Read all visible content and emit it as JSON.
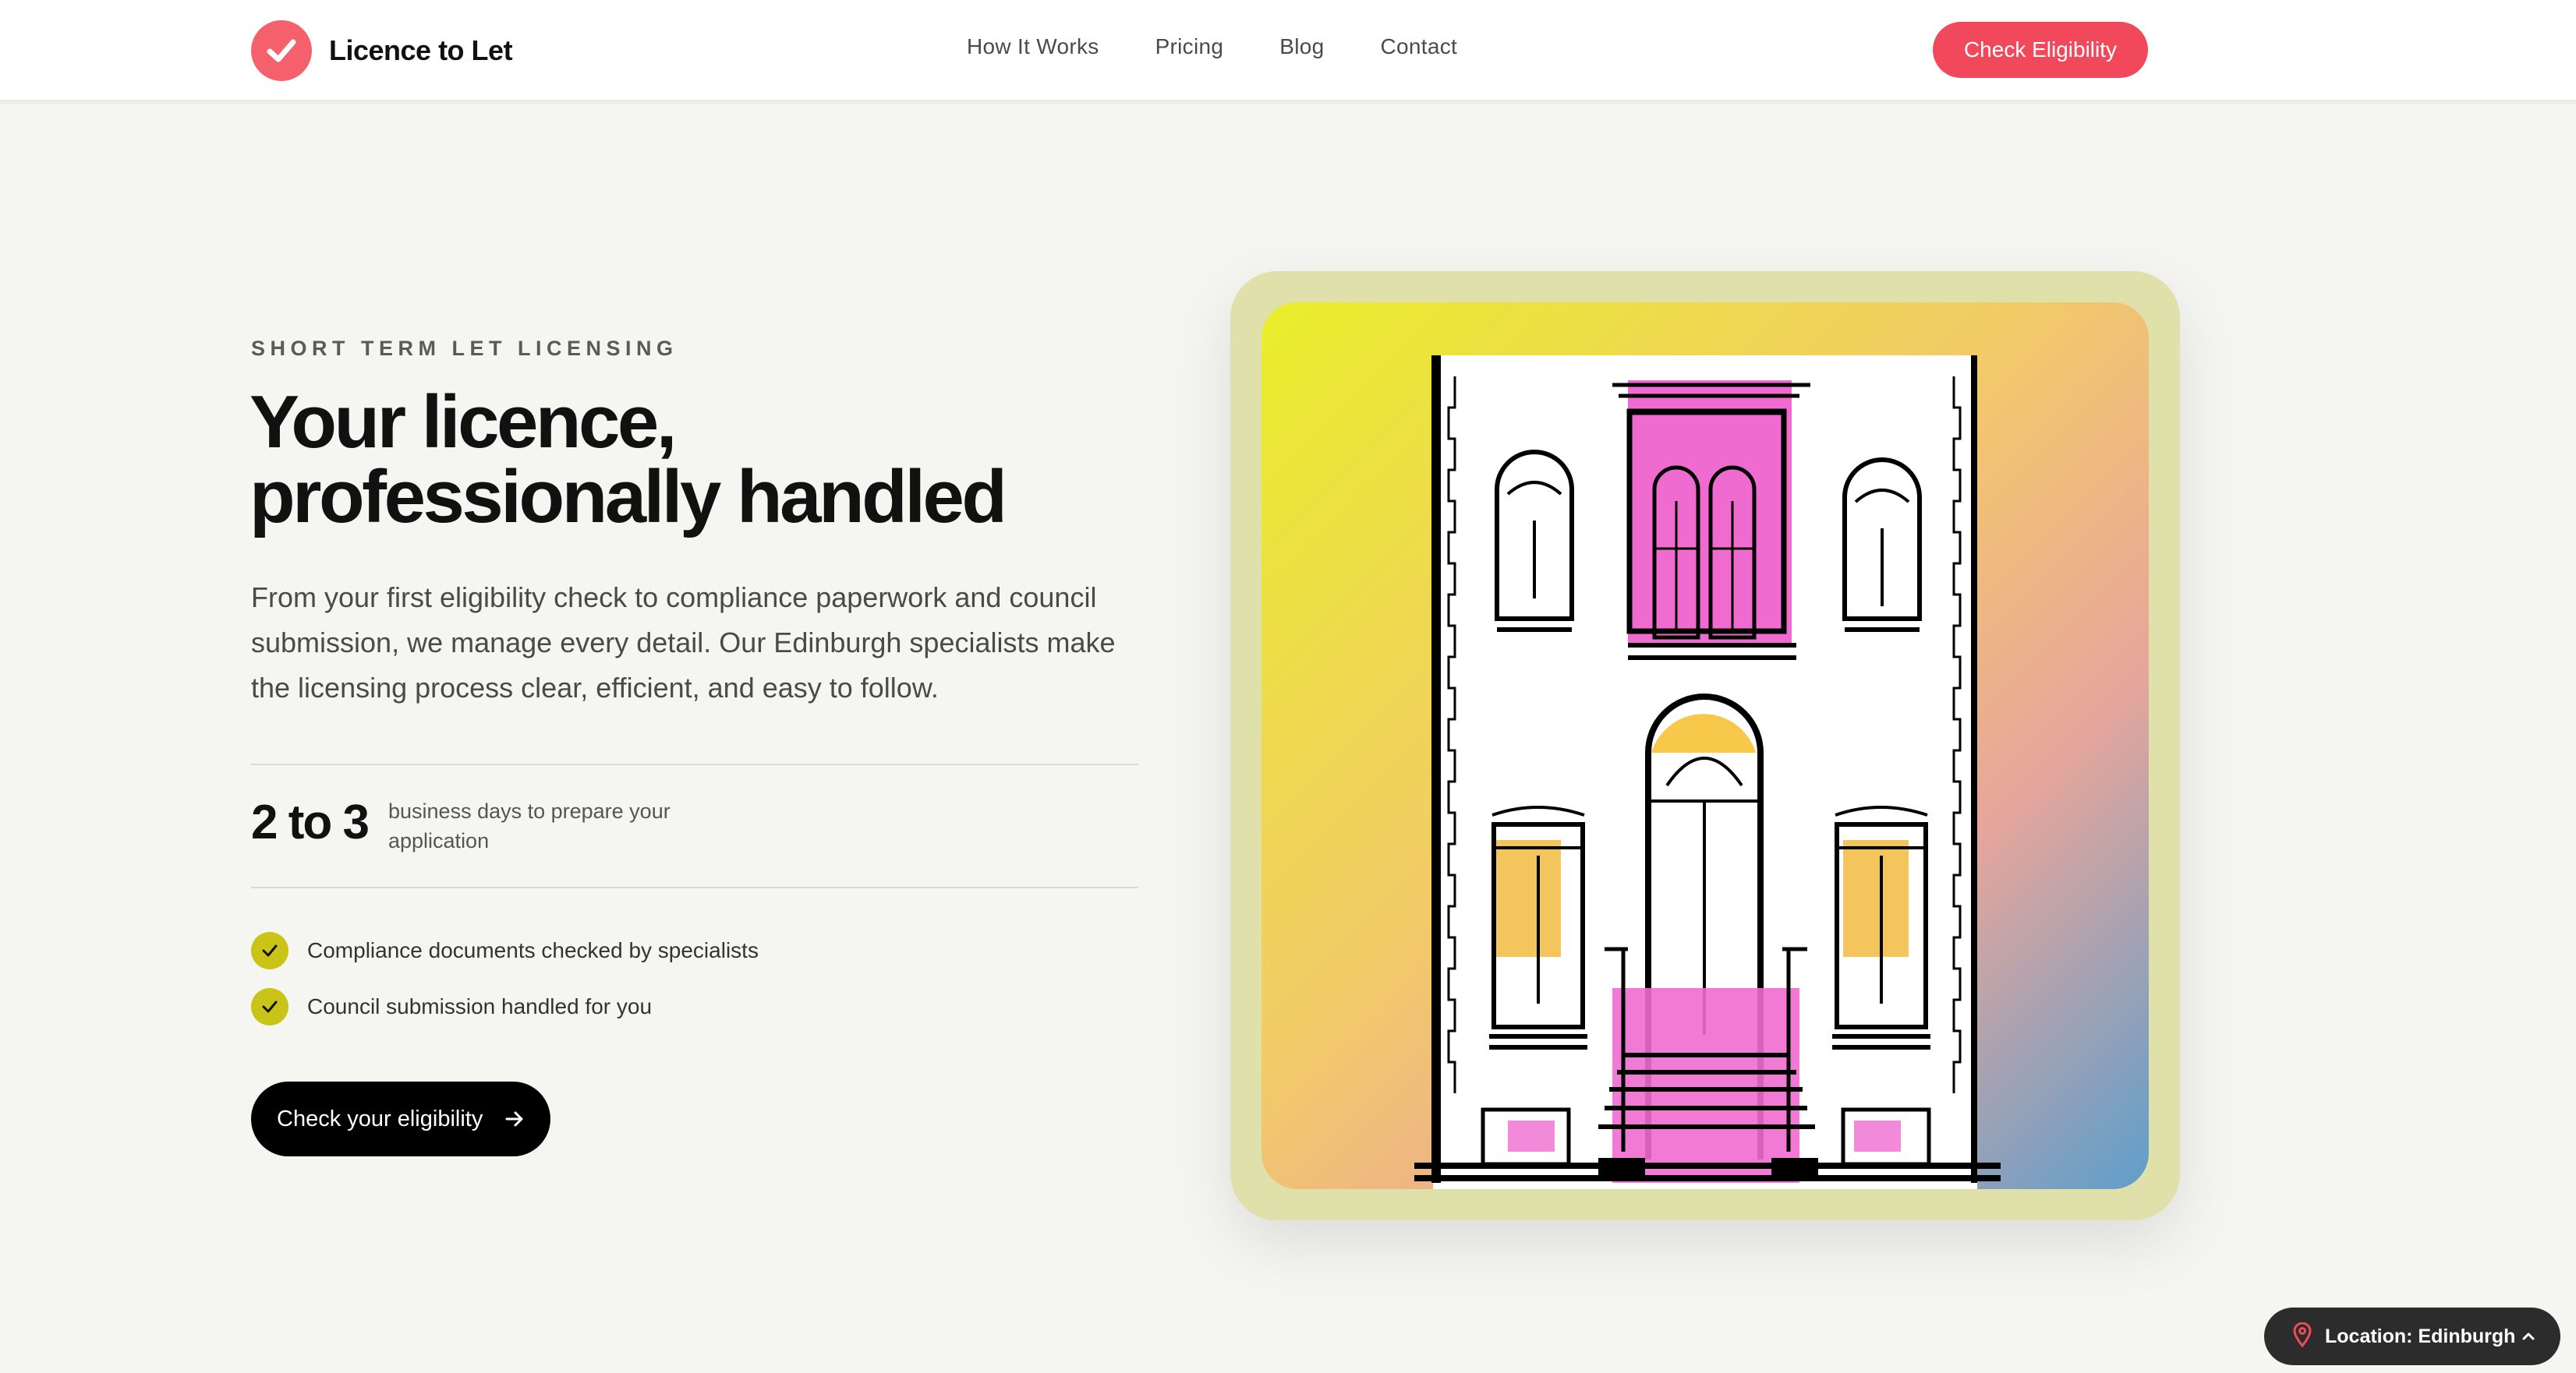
{
  "header": {
    "brand": "Licence to Let",
    "nav": [
      "How It Works",
      "Pricing",
      "Blog",
      "Contact"
    ],
    "cta": "Check Eligibility"
  },
  "hero": {
    "eyebrow": "SHORT TERM LET LICENSING",
    "title_line1": "Your licence,",
    "title_line2": "professionally handled",
    "description": "From your first eligibility check to compliance paperwork and council submission, we manage every detail. Our Edinburgh specialists make the licensing process clear, efficient, and easy to follow.",
    "stat": {
      "value": "2 to 3",
      "label": "business days to prepare your application"
    },
    "features": [
      "Compliance documents checked by specialists",
      "Council submission handled for you"
    ],
    "cta": "Check your eligibility"
  },
  "location": {
    "label": "Location: Edinburgh"
  },
  "colors": {
    "brand": "#f4606b",
    "accent": "#f2485b",
    "check_badge": "#c9c417",
    "frame": "#e0e0ab",
    "door_pink": "#f06bd0"
  },
  "icons": [
    "check-logo-icon",
    "check-icon",
    "arrow-right-icon",
    "location-pin-icon",
    "chevron-up-icon"
  ]
}
